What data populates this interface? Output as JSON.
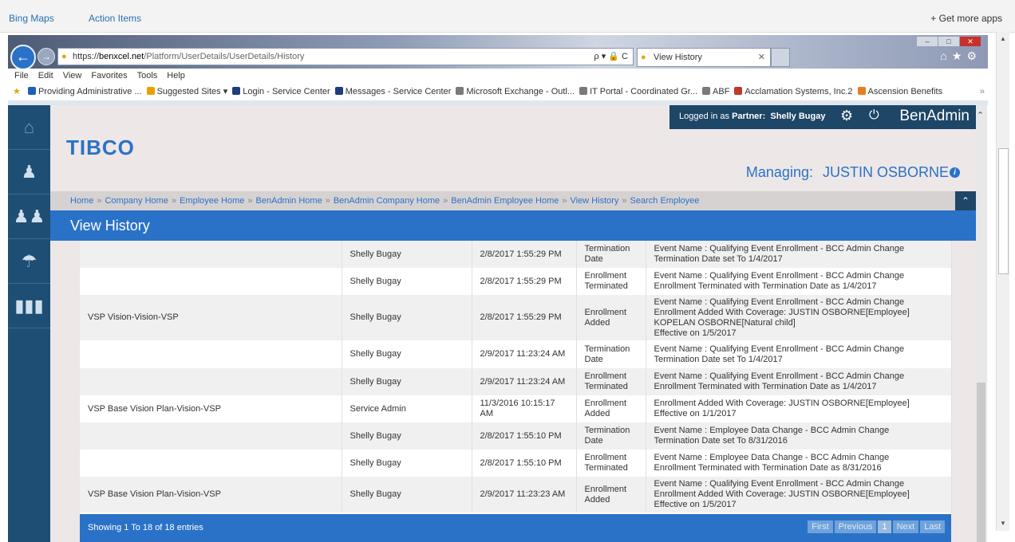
{
  "topbar": {
    "link1": "Bing Maps",
    "link2": "Action Items",
    "get_more": "+  Get more apps"
  },
  "browser": {
    "url_prefix": "https://",
    "url_host": "benxcel.net",
    "url_path": "/Platform/UserDetails/UserDetails/History",
    "addr_tools": "ρ ▾ 🔒 C",
    "tab_title": "View History",
    "menu": [
      "File",
      "Edit",
      "View",
      "Favorites",
      "Tools",
      "Help"
    ],
    "favorites": [
      {
        "label": "Providing Administrative ...",
        "color": "#1f5fb4"
      },
      {
        "label": "Suggested Sites ▾",
        "color": "#e5a400"
      },
      {
        "label": "Login - Service Center",
        "color": "#1d3e7a"
      },
      {
        "label": "Messages - Service Center",
        "color": "#1d3e7a"
      },
      {
        "label": "Microsoft Exchange - Outl...",
        "color": "#7a7a7a"
      },
      {
        "label": "IT Portal - Coordinated Gr...",
        "color": "#7a7a7a"
      },
      {
        "label": "ABF",
        "color": "#7a7a7a"
      },
      {
        "label": "Acclamation Systems, Inc.2",
        "color": "#c0392b"
      },
      {
        "label": "Ascension Benefits",
        "color": "#e67e22"
      }
    ]
  },
  "sidebar": {
    "icons": [
      "home-icon",
      "user-icon",
      "users-icon",
      "benefits-icon",
      "reports-icon"
    ]
  },
  "header": {
    "logged_in_prefix": "Logged in as ",
    "partner_label": "Partner:",
    "user": "Shelly Bugay",
    "brand": "BenAdmin",
    "logo": "TIBCO",
    "managing_label": "Managing:",
    "managing_name": "JUSTIN OSBORNE"
  },
  "breadcrumbs": [
    "Home",
    "Company Home",
    "Employee Home",
    "BenAdmin Home",
    "BenAdmin Company Home",
    "BenAdmin Employee Home",
    "View History",
    "Search Employee"
  ],
  "page_title": "View History",
  "rows": [
    {
      "plan": "",
      "user": "Shelly Bugay",
      "date": "2/8/2017 1:55:29 PM",
      "action": [
        "Termination",
        "Date"
      ],
      "desc": [
        "Event Name : Qualifying Event Enrollment - BCC Admin Change",
        "Termination Date set To 1/4/2017"
      ]
    },
    {
      "plan": "",
      "user": "Shelly Bugay",
      "date": "2/8/2017 1:55:29 PM",
      "action": [
        "Enrollment",
        "Terminated"
      ],
      "desc": [
        "Event Name : Qualifying Event Enrollment - BCC Admin Change",
        "Enrollment Terminated with Termination Date as 1/4/2017"
      ]
    },
    {
      "plan": "VSP Vision-Vision-VSP",
      "user": "Shelly Bugay",
      "date": "2/8/2017 1:55:29 PM",
      "action": [
        "Enrollment",
        "Added"
      ],
      "desc": [
        "Event Name : Qualifying Event Enrollment - BCC Admin Change",
        "Enrollment Added With Coverage: JUSTIN OSBORNE[Employee]",
        "KOPELAN OSBORNE[Natural child]",
        "Effective on 1/5/2017"
      ]
    },
    {
      "plan": "",
      "user": "Shelly Bugay",
      "date": "2/9/2017 11:23:24 AM",
      "action": [
        "Termination",
        "Date"
      ],
      "desc": [
        "Event Name : Qualifying Event Enrollment - BCC Admin Change",
        "Termination Date set To 1/4/2017"
      ]
    },
    {
      "plan": "",
      "user": "Shelly Bugay",
      "date": "2/9/2017 11:23:24 AM",
      "action": [
        "Enrollment",
        "Terminated"
      ],
      "desc": [
        "Event Name : Qualifying Event Enrollment - BCC Admin Change",
        "Enrollment Terminated with Termination Date as 1/4/2017"
      ]
    },
    {
      "plan": "VSP Base Vision Plan-Vision-VSP",
      "user": "Service Admin",
      "date": "11/3/2016 10:15:17 AM",
      "action": [
        "Enrollment",
        "Added"
      ],
      "desc": [
        "Enrollment Added With Coverage: JUSTIN OSBORNE[Employee]",
        "Effective on 1/1/2017"
      ]
    },
    {
      "plan": "",
      "user": "Shelly Bugay",
      "date": "2/8/2017 1:55:10 PM",
      "action": [
        "Termination",
        "Date"
      ],
      "desc": [
        "Event Name : Employee Data Change - BCC Admin Change",
        "Termination Date set To 8/31/2016"
      ]
    },
    {
      "plan": "",
      "user": "Shelly Bugay",
      "date": "2/8/2017 1:55:10 PM",
      "action": [
        "Enrollment",
        "Terminated"
      ],
      "desc": [
        "Event Name : Employee Data Change - BCC Admin Change",
        "Enrollment Terminated with Termination Date as 8/31/2016"
      ]
    },
    {
      "plan": "VSP Base Vision Plan-Vision-VSP",
      "user": "Shelly Bugay",
      "date": "2/9/2017 11:23:23 AM",
      "action": [
        "Enrollment",
        "Added"
      ],
      "desc": [
        "Event Name : Qualifying Event Enrollment - BCC Admin Change",
        "Enrollment Added With Coverage: JUSTIN OSBORNE[Employee]",
        "Effective on 1/5/2017"
      ]
    }
  ],
  "footer": {
    "showing": "Showing 1 To 18 of 18 entries",
    "pager": [
      "First",
      "Previous",
      "1",
      "Next",
      "Last"
    ],
    "current_page": "1"
  }
}
